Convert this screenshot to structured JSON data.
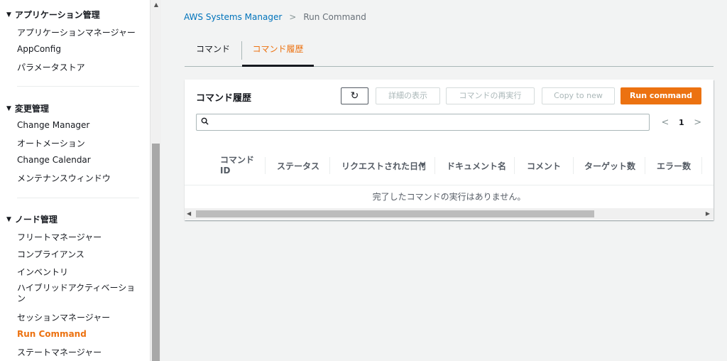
{
  "sidebar": {
    "sections": [
      {
        "title": "アプリケーション管理",
        "items": [
          "アプリケーションマネージャー",
          "AppConfig",
          "パラメータストア"
        ]
      },
      {
        "title": "変更管理",
        "items": [
          "Change Manager",
          "オートメーション",
          "Change Calendar",
          "メンテナンスウィンドウ"
        ]
      },
      {
        "title": "ノード管理",
        "items": [
          "フリートマネージャー",
          "コンプライアンス",
          "インベントリ",
          "ハイブリッドアクティベーション",
          "セッションマネージャー",
          "Run Command",
          "ステートマネージャー"
        ]
      }
    ],
    "active_item": "Run Command",
    "caret": "▼"
  },
  "scrollbar": {
    "up_arrow": "▲"
  },
  "breadcrumb": {
    "root": "AWS Systems Manager",
    "separator": ">",
    "current": "Run Command"
  },
  "tabs": [
    {
      "label": "コマンド",
      "active": false
    },
    {
      "label": "コマンド履歴",
      "active": true
    }
  ],
  "panel": {
    "title": "コマンド履歴",
    "buttons": {
      "refresh_icon": "refresh-icon",
      "refresh_glyph": "↻",
      "details": "詳細の表示",
      "rerun": "コマンドの再実行",
      "copy": "Copy to new",
      "run": "Run command"
    },
    "search": {
      "placeholder": "",
      "value": ""
    },
    "pager": {
      "prev": "<",
      "page": "1",
      "next": ">"
    },
    "columns": [
      {
        "label_line1": "コマンド",
        "label_line2": "ID"
      },
      {
        "label": "ステータス"
      },
      {
        "label": "リクエストされた日付"
      },
      {
        "label": "ドキュメント名"
      },
      {
        "label": "コメント"
      },
      {
        "label": "ターゲット数"
      },
      {
        "label": "エラー数"
      }
    ],
    "sort_indicator": "▼",
    "empty_message": "完了したコマンドの実行はありません。",
    "hscroll": {
      "left": "◀",
      "right": "▶"
    }
  },
  "colors": {
    "accent": "#ec7211",
    "link": "#0073bb",
    "text": "#16191f"
  }
}
